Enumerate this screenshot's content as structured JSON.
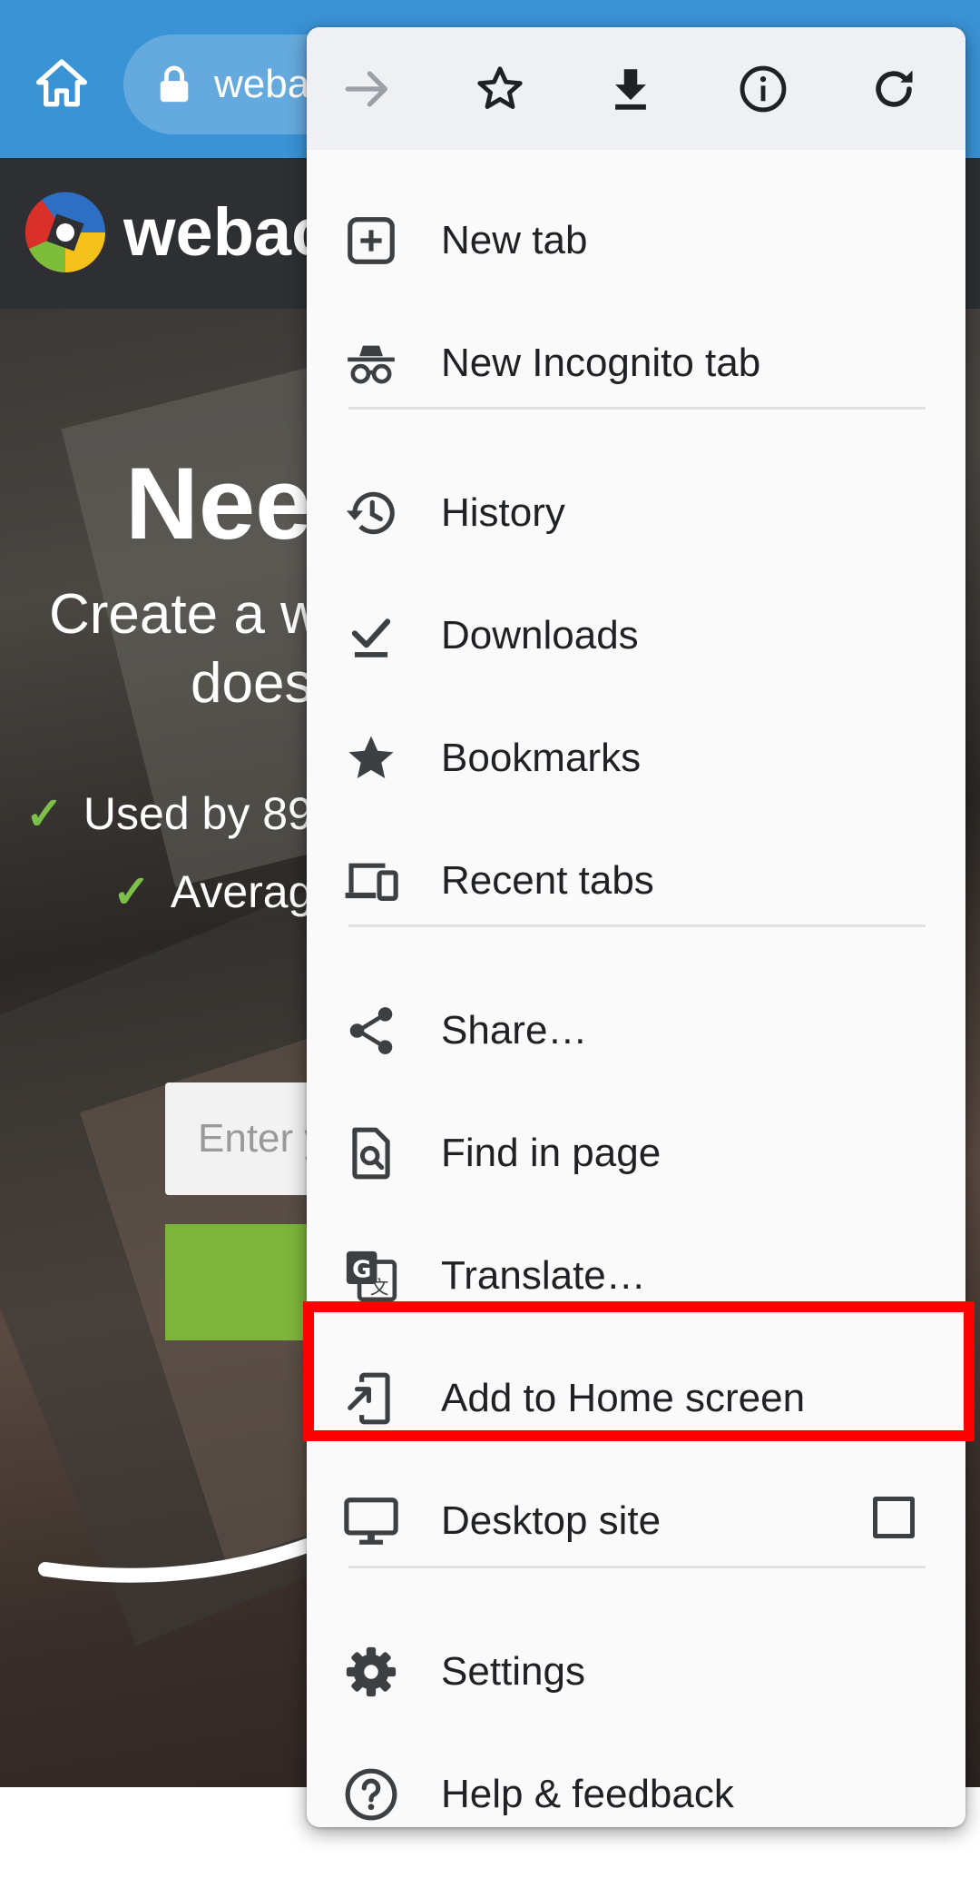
{
  "browser": {
    "url_text": "weba",
    "toolbar_color": "#3a93d5"
  },
  "site": {
    "name": "webac",
    "hero_title": "Nee",
    "hero_subtitle_line1": "Create a w",
    "hero_subtitle_line2": "does",
    "checks": [
      "Used by 89",
      "Averag"
    ],
    "check_mark": "✓",
    "email_placeholder": "Enter y",
    "cta_color": "#7db43a"
  },
  "menu": {
    "icon_bar": [
      "forward-icon",
      "bookmark-star-icon",
      "download-icon",
      "page-info-icon",
      "reload-icon"
    ],
    "items": [
      {
        "label": "New tab",
        "icon": "new-tab-icon"
      },
      {
        "label": "New Incognito tab",
        "icon": "incognito-icon"
      },
      {
        "label": "History",
        "icon": "history-icon"
      },
      {
        "label": "Downloads",
        "icon": "downloads-icon"
      },
      {
        "label": "Bookmarks",
        "icon": "bookmarks-star-icon"
      },
      {
        "label": "Recent tabs",
        "icon": "recent-tabs-icon"
      },
      {
        "label": "Share…",
        "icon": "share-icon"
      },
      {
        "label": "Find in page",
        "icon": "find-in-page-icon"
      },
      {
        "label": "Translate…",
        "icon": "translate-icon"
      },
      {
        "label": "Add to Home screen",
        "icon": "add-to-home-screen-icon",
        "highlighted": true
      },
      {
        "label": "Desktop site",
        "icon": "desktop-icon",
        "checkbox": false
      },
      {
        "label": "Settings",
        "icon": "settings-gear-icon"
      },
      {
        "label": "Help & feedback",
        "icon": "help-icon"
      }
    ],
    "highlight_color": "#ff0000"
  }
}
